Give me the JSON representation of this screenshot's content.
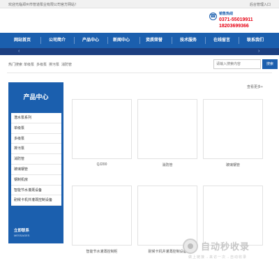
{
  "topbar": {
    "welcome": "欢迎光临郑州市管道泵业有限公司官方网站！",
    "admin": "后台管理入口"
  },
  "hotline": {
    "label": "销售热线",
    "phone1": "0371-55019911",
    "phone2": "18203699366"
  },
  "nav": [
    "网站首页",
    "公司简介",
    "产品中心",
    "新闻中心",
    "资质荣誉",
    "技术服务",
    "在线留言",
    "联系我们"
  ],
  "breadcrumb": [
    "热门搜索",
    "单级泵",
    "多级泵",
    "排污泵",
    "消防管"
  ],
  "search": {
    "placeholder": "请输入搜索内容",
    "button": "搜索"
  },
  "sidebar": {
    "title": "产品中心",
    "items": [
      "潜水泵系列",
      "单级泵",
      "多级泵",
      "排污泵",
      "消防管",
      "玻璃钢管",
      "钢制机房",
      "智能节水灌溉设备",
      "耐候卡机井灌溉控制设备"
    ],
    "contact": "立即联系",
    "contact_en": "MESSAGES"
  },
  "main": {
    "more": "查看更多+",
    "products": [
      {
        "caption": "QJ200"
      },
      {
        "caption": "消防管"
      },
      {
        "caption": "玻璃钢管"
      },
      {
        "caption": ""
      },
      {
        "caption": "智能节水灌溉控制柜"
      },
      {
        "caption": "耐候卡机井灌溉控制设备"
      }
    ]
  },
  "watermark": {
    "title": "自动秒收录",
    "subtitle": "做上链接→来访一次→自动收录"
  },
  "icons": {
    "phone": "phone-icon",
    "prev": "chevron-left-icon",
    "next": "chevron-right-icon"
  }
}
